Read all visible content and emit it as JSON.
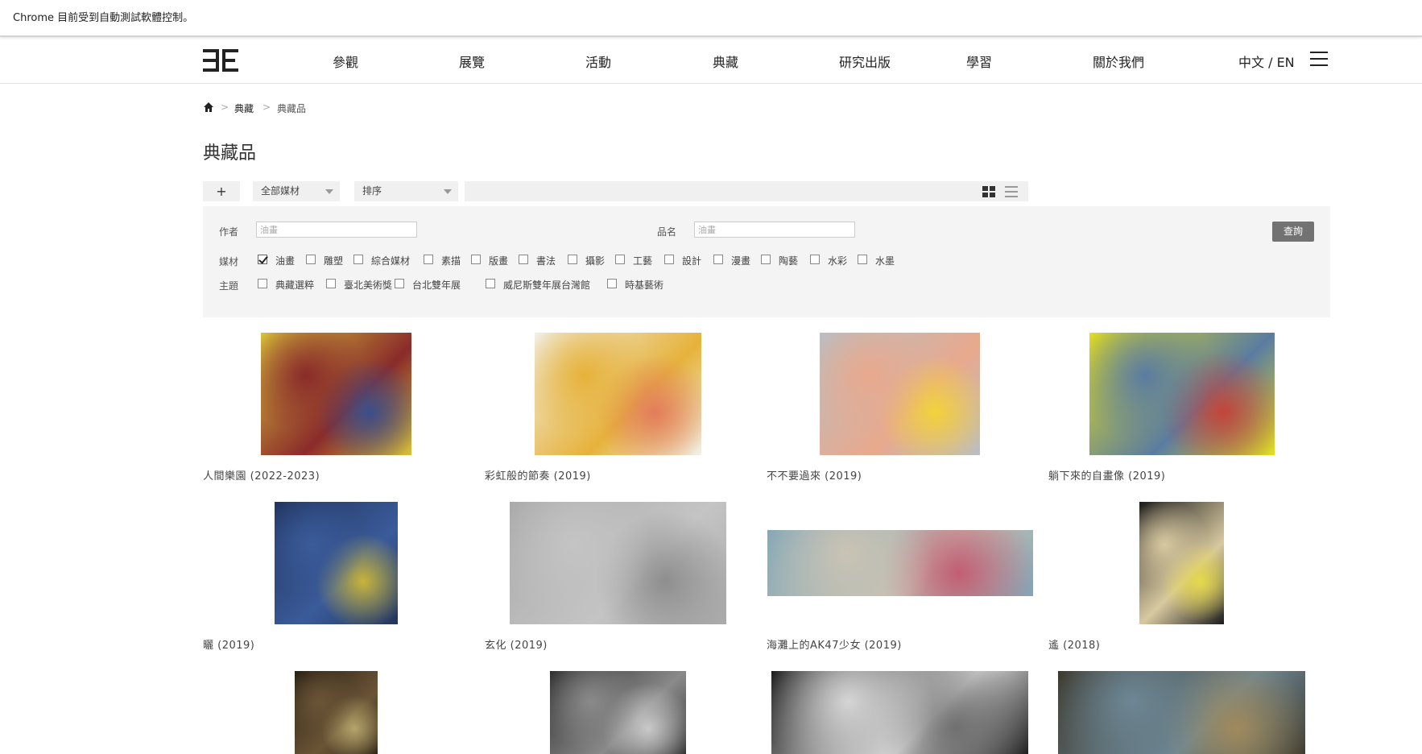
{
  "browser": {
    "infobar_text": "Chrome 目前受到自動測試軟體控制。"
  },
  "header": {
    "logo_alt": "北美館",
    "nav": [
      "參觀",
      "展覽",
      "活動",
      "典藏",
      "研究出版",
      "學習",
      "關於我們"
    ],
    "lang": "中文 / EN"
  },
  "breadcrumb": {
    "items": [
      "典藏",
      "典藏品"
    ],
    "separator": ">"
  },
  "page": {
    "title": "典藏品"
  },
  "toolbar": {
    "plus": "+",
    "medium_select": "全部媒材",
    "sort_select": "排序",
    "search_placeholder": ""
  },
  "filters": {
    "author_label": "作者",
    "author_placeholder": "油畫",
    "title_label": "品名",
    "title_placeholder": "油畫",
    "query_button": "查詢",
    "medium_label": "媒材",
    "media": [
      {
        "label": "油畫",
        "checked": true
      },
      {
        "label": "雕塑",
        "checked": false
      },
      {
        "label": "綜合媒材",
        "checked": false
      },
      {
        "label": "素描",
        "checked": false
      },
      {
        "label": "版畫",
        "checked": false
      },
      {
        "label": "書法",
        "checked": false
      },
      {
        "label": "攝影",
        "checked": false
      },
      {
        "label": "工藝",
        "checked": false
      },
      {
        "label": "設計",
        "checked": false
      },
      {
        "label": "漫畫",
        "checked": false
      },
      {
        "label": "陶藝",
        "checked": false
      },
      {
        "label": "水彩",
        "checked": false
      },
      {
        "label": "水墨",
        "checked": false
      }
    ],
    "theme_label": "主題",
    "themes": [
      {
        "label": "典藏選粹",
        "checked": false
      },
      {
        "label": "臺北美術獎",
        "checked": false
      },
      {
        "label": "台北雙年展",
        "checked": false
      },
      {
        "label": "威尼斯雙年展台灣館",
        "checked": false
      },
      {
        "label": "時基藝術",
        "checked": false
      }
    ]
  },
  "artworks": [
    {
      "caption": "人間樂園 (2022-2023)",
      "colors": [
        "#d8c23a",
        "#8a2b2b",
        "#3a4f8a"
      ]
    },
    {
      "caption": "彩虹般的節奏 (2019)",
      "colors": [
        "#f1f0ea",
        "#e6b23a",
        "#e37c5c"
      ]
    },
    {
      "caption": "不不要過來 (2019)",
      "colors": [
        "#b9bec4",
        "#e8a98d",
        "#f2d23a"
      ]
    },
    {
      "caption": "躺下來的自畫像 (2019)",
      "colors": [
        "#e6df1c",
        "#5a7ca1",
        "#c3453a"
      ]
    },
    {
      "caption": "曬 (2019)",
      "colors": [
        "#22345e",
        "#3a5b9a",
        "#c8b43a"
      ]
    },
    {
      "caption": "玄化 (2019)",
      "colors": [
        "#a9a9a9",
        "#c4c4c4",
        "#8e8e8e"
      ]
    },
    {
      "caption": "海灘上的AK47少女 (2019)",
      "colors": [
        "#7fa6b8",
        "#c9c3b4",
        "#c25d72"
      ]
    },
    {
      "caption": "遙 (2018)",
      "colors": [
        "#1c1c1c",
        "#d8c9a0",
        "#e6d84a"
      ]
    },
    {
      "caption": "",
      "colors": [
        "#2a2015",
        "#6b5536",
        "#b5a46a"
      ]
    },
    {
      "caption": "",
      "colors": [
        "#2d2d2d",
        "#8a8a8a",
        "#c9c9c9"
      ]
    },
    {
      "caption": "",
      "colors": [
        "#151515",
        "#d5d5d5",
        "#707070"
      ]
    },
    {
      "caption": "",
      "colors": [
        "#3b3528",
        "#6d8795",
        "#a08a5c"
      ]
    }
  ]
}
